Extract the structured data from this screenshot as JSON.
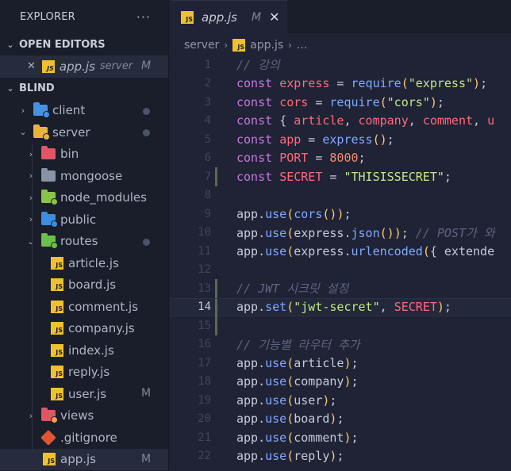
{
  "sidebar": {
    "title": "EXPLORER",
    "more": "···",
    "open_editors_label": "OPEN EDITORS",
    "open_editor": {
      "name": "app.js",
      "folder": "server",
      "status": "M"
    },
    "project_label": "BLIND",
    "tree": {
      "client": "client",
      "server": "server",
      "bin": "bin",
      "mongoose": "mongoose",
      "node_modules": "node_modules",
      "public": "public",
      "routes": "routes",
      "files": [
        "article.js",
        "board.js",
        "comment.js",
        "company.js",
        "index.js",
        "reply.js",
        "user.js"
      ],
      "user_status": "M",
      "views": "views",
      "gitignore": ".gitignore",
      "appjs": "app.js",
      "appjs_status": "M"
    }
  },
  "editor": {
    "tab": {
      "name": "app.js",
      "status": "M",
      "close": "✕"
    },
    "breadcrumb": {
      "folder": "server",
      "file": "app.js",
      "more": "..."
    },
    "active_line": 14,
    "lines": [
      {
        "n": "1",
        "tokens": [
          [
            "c",
            "// 강의"
          ]
        ]
      },
      {
        "n": "2",
        "tokens": [
          [
            "k",
            "const "
          ],
          [
            "v",
            "express"
          ],
          [
            "p",
            " = "
          ],
          [
            "f",
            "require"
          ],
          [
            "y",
            "("
          ],
          [
            "s",
            "\"express\""
          ],
          [
            "y",
            ")"
          ],
          [
            "p",
            ";"
          ]
        ]
      },
      {
        "n": "3",
        "tokens": [
          [
            "k",
            "const "
          ],
          [
            "v",
            "cors"
          ],
          [
            "p",
            " = "
          ],
          [
            "f",
            "require"
          ],
          [
            "y",
            "("
          ],
          [
            "s",
            "\"cors\""
          ],
          [
            "y",
            ")"
          ],
          [
            "p",
            ";"
          ]
        ]
      },
      {
        "n": "4",
        "tokens": [
          [
            "k",
            "const "
          ],
          [
            "p",
            "{ "
          ],
          [
            "v",
            "article"
          ],
          [
            "p",
            ", "
          ],
          [
            "v",
            "company"
          ],
          [
            "p",
            ", "
          ],
          [
            "v",
            "comment"
          ],
          [
            "p",
            ", "
          ],
          [
            "v",
            "u"
          ]
        ]
      },
      {
        "n": "5",
        "tokens": [
          [
            "k",
            "const "
          ],
          [
            "v",
            "app"
          ],
          [
            "p",
            " = "
          ],
          [
            "f",
            "express"
          ],
          [
            "y",
            "()"
          ],
          [
            "p",
            ";"
          ]
        ]
      },
      {
        "n": "6",
        "tokens": [
          [
            "k",
            "const "
          ],
          [
            "v",
            "PORT"
          ],
          [
            "p",
            " = "
          ],
          [
            "n",
            "8000"
          ],
          [
            "p",
            ";"
          ]
        ]
      },
      {
        "n": "7",
        "tokens": [
          [
            "k",
            "const "
          ],
          [
            "v",
            "SECRET"
          ],
          [
            "p",
            " = "
          ],
          [
            "s",
            "\"THISISSECRET\""
          ],
          [
            "p",
            ";"
          ]
        ]
      },
      {
        "n": "8",
        "tokens": []
      },
      {
        "n": "9",
        "tokens": [
          [
            "p",
            "app."
          ],
          [
            "f",
            "use"
          ],
          [
            "y",
            "("
          ],
          [
            "f",
            "cors"
          ],
          [
            "y",
            "()"
          ],
          [
            "y",
            ")"
          ],
          [
            "p",
            ";"
          ]
        ]
      },
      {
        "n": "10",
        "tokens": [
          [
            "p",
            "app."
          ],
          [
            "f",
            "use"
          ],
          [
            "y",
            "("
          ],
          [
            "p",
            "express."
          ],
          [
            "f",
            "json"
          ],
          [
            "y",
            "()"
          ],
          [
            "y",
            ")"
          ],
          [
            "p",
            "; "
          ],
          [
            "c",
            "// POST가 와"
          ]
        ]
      },
      {
        "n": "11",
        "tokens": [
          [
            "p",
            "app."
          ],
          [
            "f",
            "use"
          ],
          [
            "y",
            "("
          ],
          [
            "p",
            "express."
          ],
          [
            "f",
            "urlencoded"
          ],
          [
            "y",
            "("
          ],
          [
            "p",
            "{ extende"
          ]
        ]
      },
      {
        "n": "12",
        "tokens": []
      },
      {
        "n": "13",
        "tokens": [
          [
            "c",
            "// JWT 시크릿 설정"
          ]
        ]
      },
      {
        "n": "14",
        "tokens": [
          [
            "p",
            "app."
          ],
          [
            "f",
            "set"
          ],
          [
            "y",
            "("
          ],
          [
            "s",
            "\"jwt-secret\""
          ],
          [
            "p",
            ", "
          ],
          [
            "v",
            "SECRET"
          ],
          [
            "y",
            ")"
          ],
          [
            "p",
            ";"
          ]
        ]
      },
      {
        "n": "15",
        "tokens": []
      },
      {
        "n": "16",
        "tokens": [
          [
            "c",
            "// 기능별 라우터 추가"
          ]
        ]
      },
      {
        "n": "17",
        "tokens": [
          [
            "p",
            "app."
          ],
          [
            "f",
            "use"
          ],
          [
            "y",
            "("
          ],
          [
            "p",
            "article"
          ],
          [
            "y",
            ")"
          ],
          [
            "p",
            ";"
          ]
        ]
      },
      {
        "n": "18",
        "tokens": [
          [
            "p",
            "app."
          ],
          [
            "f",
            "use"
          ],
          [
            "y",
            "("
          ],
          [
            "p",
            "company"
          ],
          [
            "y",
            ")"
          ],
          [
            "p",
            ";"
          ]
        ]
      },
      {
        "n": "19",
        "tokens": [
          [
            "p",
            "app."
          ],
          [
            "f",
            "use"
          ],
          [
            "y",
            "("
          ],
          [
            "p",
            "user"
          ],
          [
            "y",
            ")"
          ],
          [
            "p",
            ";"
          ]
        ]
      },
      {
        "n": "20",
        "tokens": [
          [
            "p",
            "app."
          ],
          [
            "f",
            "use"
          ],
          [
            "y",
            "("
          ],
          [
            "p",
            "board"
          ],
          [
            "y",
            ")"
          ],
          [
            "p",
            ";"
          ]
        ]
      },
      {
        "n": "21",
        "tokens": [
          [
            "p",
            "app."
          ],
          [
            "f",
            "use"
          ],
          [
            "y",
            "("
          ],
          [
            "p",
            "comment"
          ],
          [
            "y",
            ")"
          ],
          [
            "p",
            ";"
          ]
        ]
      },
      {
        "n": "22",
        "tokens": [
          [
            "p",
            "app."
          ],
          [
            "f",
            "use"
          ],
          [
            "y",
            "("
          ],
          [
            "p",
            "reply"
          ],
          [
            "y",
            ")"
          ],
          [
            "p",
            ";"
          ]
        ]
      }
    ],
    "modified_lines": [
      "7",
      "13",
      "14",
      "15"
    ]
  }
}
